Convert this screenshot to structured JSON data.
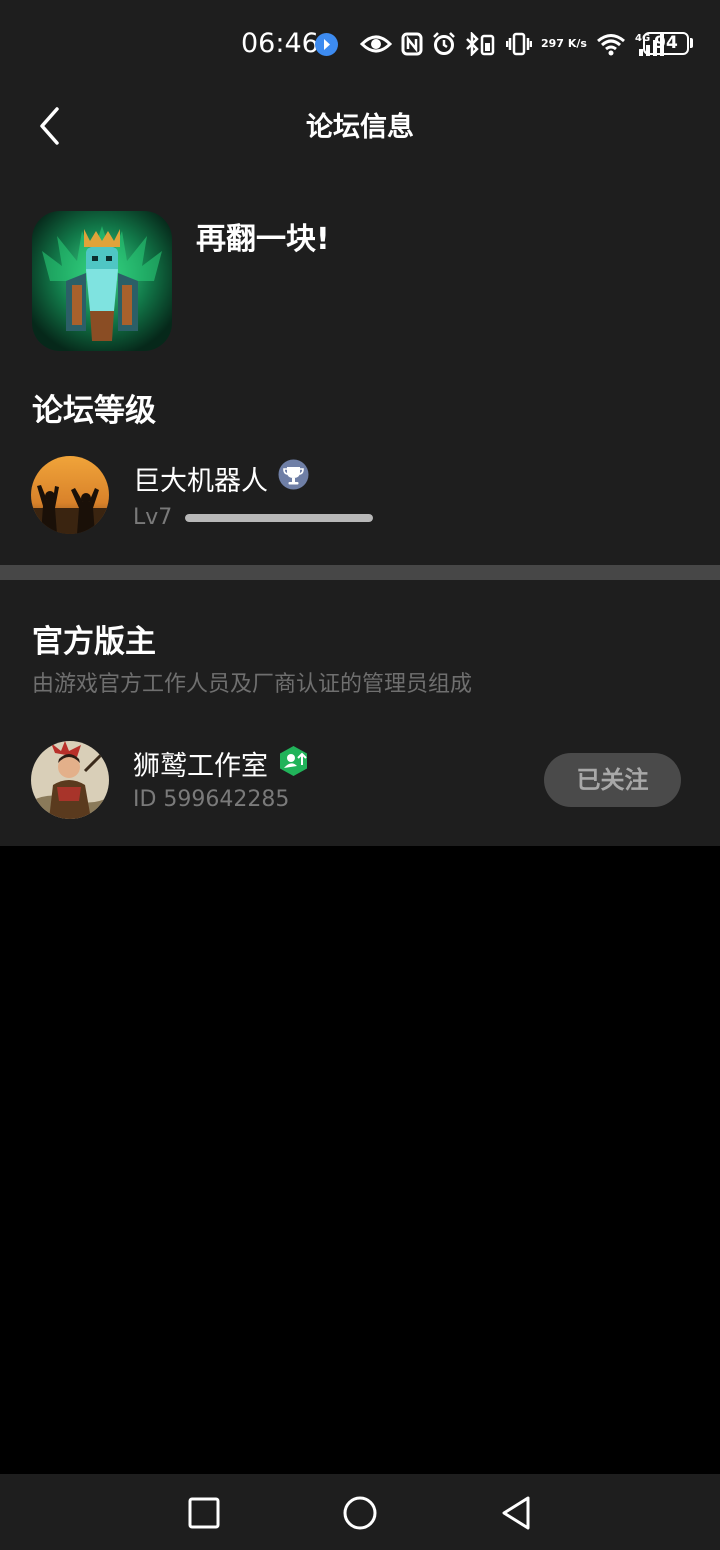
{
  "status_bar": {
    "time": "06:46",
    "speed_value": "297",
    "speed_unit": "K/s",
    "network": "4G",
    "battery": "94"
  },
  "header": {
    "title": "论坛信息"
  },
  "forum": {
    "name": "再翻一块!"
  },
  "level_section": {
    "title": "论坛等级",
    "user": {
      "name": "巨大机器人",
      "level": "Lv7",
      "progress": 1.0
    }
  },
  "moderator_section": {
    "title": "官方版主",
    "subtitle": "由游戏官方工作人员及厂商认证的管理员组成",
    "moderator": {
      "name": "狮鹫工作室",
      "id": "ID 599642285",
      "follow_label": "已关注"
    }
  },
  "colors": {
    "background": "#000000",
    "panel": "#1e1e1e",
    "divider": "#474747",
    "accent_green": "#21b35a",
    "muted_text": "#7a7a7a"
  },
  "icons": {
    "back": "chevron-left-icon",
    "trophy_badge": "trophy-badge-icon",
    "official_badge": "official-badge-icon",
    "nav_recents": "square-icon",
    "nav_home": "circle-icon",
    "nav_back": "triangle-back-icon"
  }
}
